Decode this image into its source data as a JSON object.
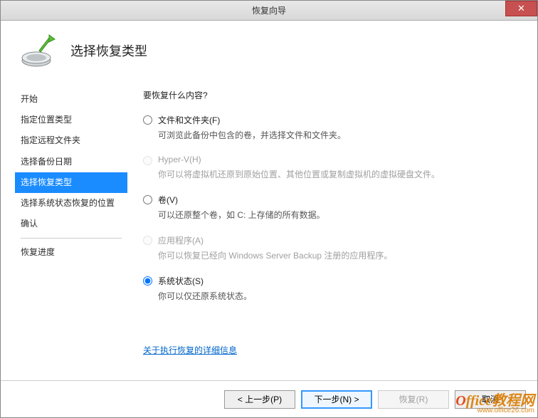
{
  "titlebar": {
    "title": "恢复向导",
    "close_glyph": "✕"
  },
  "header": {
    "title": "选择恢复类型"
  },
  "sidebar": {
    "items": [
      {
        "label": "开始"
      },
      {
        "label": "指定位置类型"
      },
      {
        "label": "指定远程文件夹"
      },
      {
        "label": "选择备份日期"
      },
      {
        "label": "选择恢复类型",
        "selected": true
      },
      {
        "label": "选择系统状态恢复的位置"
      },
      {
        "label": "确认"
      }
    ],
    "after_sep": [
      {
        "label": "恢复进度"
      }
    ]
  },
  "main": {
    "prompt": "要恢复什么内容?",
    "options": [
      {
        "key": "files",
        "label": "文件和文件夹(F)",
        "desc": "可浏览此备份中包含的卷，并选择文件和文件夹。",
        "disabled": false,
        "checked": false
      },
      {
        "key": "hyperv",
        "label": "Hyper-V(H)",
        "desc": "你可以将虚拟机还原到原始位置、其他位置或复制虚拟机的虚拟硬盘文件。",
        "disabled": true,
        "checked": false
      },
      {
        "key": "volumes",
        "label": "卷(V)",
        "desc": "可以还原整个卷，如 C: 上存储的所有数据。",
        "disabled": false,
        "checked": false
      },
      {
        "key": "apps",
        "label": "应用程序(A)",
        "desc": "你可以恢复已经向 Windows Server Backup 注册的应用程序。",
        "disabled": true,
        "checked": false
      },
      {
        "key": "sysstate",
        "label": "系统状态(S)",
        "desc": "你可以仅还原系统状态。",
        "disabled": false,
        "checked": true
      }
    ],
    "details_link": "关于执行恢复的详细信息"
  },
  "footer": {
    "prev": "< 上一步(P)",
    "next": "下一步(N) >",
    "recover": "恢复(R)",
    "cancel": "取消"
  },
  "watermark": {
    "brand_html_o": "O",
    "brand_rest": "ffice教程网",
    "url": "www.office26.com"
  }
}
